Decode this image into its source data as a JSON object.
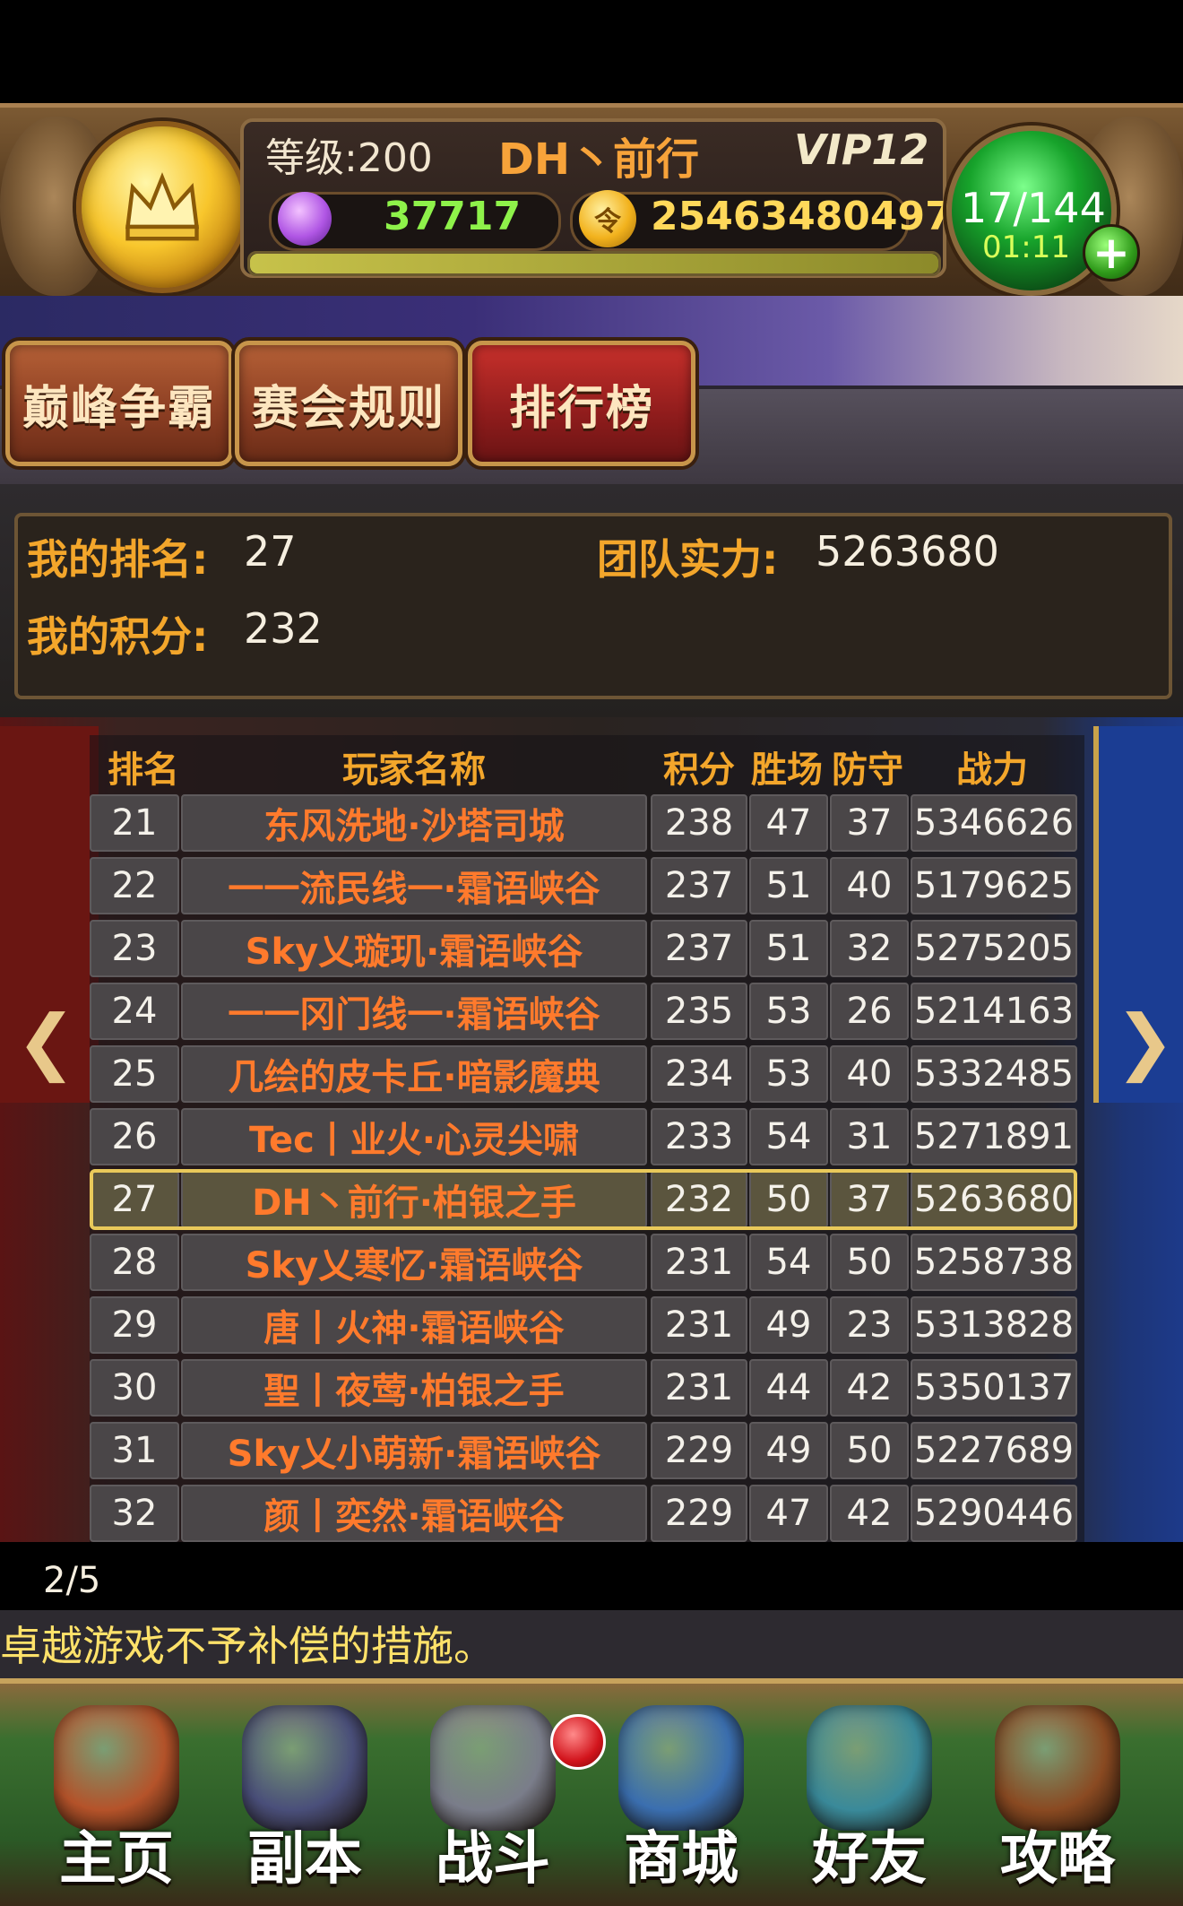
{
  "header": {
    "level": "等级:200",
    "player_name": "DH丶前行",
    "vip": "VIP12",
    "gems": "37717",
    "gold": "25463480497",
    "coin_glyph": "令",
    "energy": "17/144",
    "energy_timer": "01:11",
    "exp_progress": 1.0
  },
  "tabs": [
    {
      "label": "巅峰争霸"
    },
    {
      "label": "赛会规则"
    },
    {
      "label": "排行榜",
      "active": true
    }
  ],
  "my_stats": {
    "rank_label": "我的排名:",
    "rank_value": "27",
    "power_label": "团队实力:",
    "power_value": "5263680",
    "score_label": "我的积分:",
    "score_value": "232"
  },
  "table": {
    "headers": {
      "rank": "排名",
      "name": "玩家名称",
      "score": "积分",
      "wins": "胜场",
      "defense": "防守",
      "power": "战力"
    },
    "rows": [
      {
        "rank": "21",
        "name": "东风洗地·沙塔司城",
        "score": "238",
        "wins": "47",
        "defense": "37",
        "power": "5346626"
      },
      {
        "rank": "22",
        "name": "一一流民线一·霜语峡谷",
        "score": "237",
        "wins": "51",
        "defense": "40",
        "power": "5179625"
      },
      {
        "rank": "23",
        "name": "Sky乂璇玑·霜语峡谷",
        "score": "237",
        "wins": "51",
        "defense": "32",
        "power": "5275205"
      },
      {
        "rank": "24",
        "name": "一一冈门线一·霜语峡谷",
        "score": "235",
        "wins": "53",
        "defense": "26",
        "power": "5214163"
      },
      {
        "rank": "25",
        "name": "几绘的皮卡丘·暗影魔典",
        "score": "234",
        "wins": "53",
        "defense": "40",
        "power": "5332485"
      },
      {
        "rank": "26",
        "name": "Tec丨业火·心灵尖啸",
        "score": "233",
        "wins": "54",
        "defense": "31",
        "power": "5271891"
      },
      {
        "rank": "27",
        "name": "DH丶前行·柏银之手",
        "score": "232",
        "wins": "50",
        "defense": "37",
        "power": "5263680",
        "mine": true
      },
      {
        "rank": "28",
        "name": "Sky乂寒忆·霜语峡谷",
        "score": "231",
        "wins": "54",
        "defense": "50",
        "power": "5258738"
      },
      {
        "rank": "29",
        "name": "唐丨火神·霜语峡谷",
        "score": "231",
        "wins": "49",
        "defense": "23",
        "power": "5313828"
      },
      {
        "rank": "30",
        "name": "聖丨夜莺·柏银之手",
        "score": "231",
        "wins": "44",
        "defense": "42",
        "power": "5350137"
      },
      {
        "rank": "31",
        "name": "Sky乂小萌新·霜语峡谷",
        "score": "229",
        "wins": "49",
        "defense": "50",
        "power": "5227689"
      },
      {
        "rank": "32",
        "name": "颜丨奕然·霜语峡谷",
        "score": "229",
        "wins": "47",
        "defense": "42",
        "power": "5290446"
      }
    ]
  },
  "pagination": "2/5",
  "notice": "卓越游戏不予补偿的措施。",
  "nav": [
    {
      "label": "主页",
      "icon": "home-icon",
      "color": "#b5532a"
    },
    {
      "label": "副本",
      "icon": "skull-icon",
      "color": "#4a4f7a"
    },
    {
      "label": "战斗",
      "icon": "sword-icon",
      "color": "#7a7d8a"
    },
    {
      "label": "商城",
      "icon": "monster-shop-icon",
      "color": "#3b6fb0"
    },
    {
      "label": "好友",
      "icon": "friends-icon",
      "color": "#3a8a9a"
    },
    {
      "label": "攻略",
      "icon": "book-icon",
      "color": "#8a4a22"
    }
  ],
  "colors": {
    "accent_orange": "#f3a62b",
    "name_orange": "#ff7a2c",
    "highlight": "#e9c95a"
  }
}
